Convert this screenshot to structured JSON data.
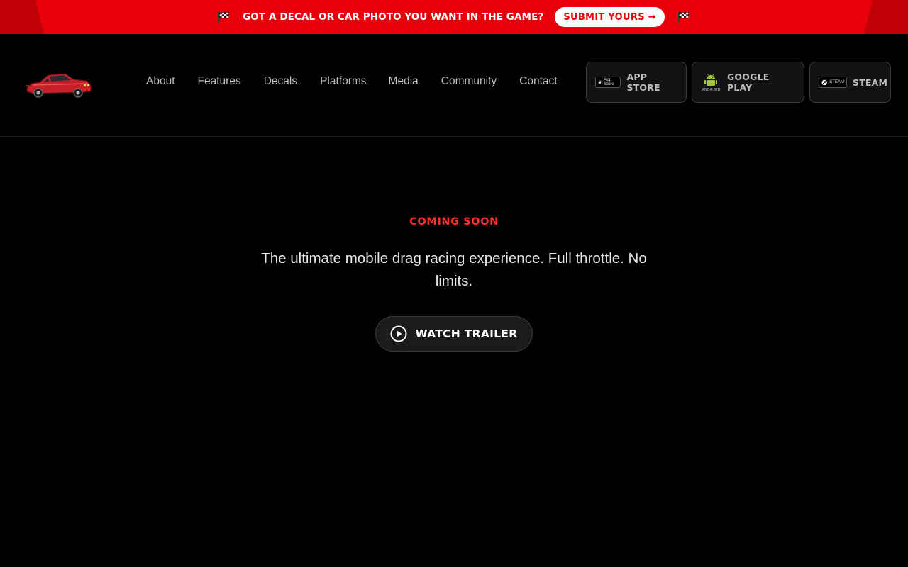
{
  "promo": {
    "text": "GOT A DECAL OR CAR PHOTO YOU WANT IN THE GAME?",
    "button_label": "SUBMIT YOURS →",
    "left_icon": "checkered-flag-icon",
    "right_icon": "checkered-flag-icon",
    "background_color": "#e8000b"
  },
  "header": {
    "logo_icon": "red-car-logo-icon",
    "nav": [
      {
        "label": "About"
      },
      {
        "label": "Features"
      },
      {
        "label": "Decals"
      },
      {
        "label": "Platforms"
      },
      {
        "label": "Media"
      },
      {
        "label": "Community"
      },
      {
        "label": "Contact"
      }
    ],
    "stores": [
      {
        "label": "APP STORE",
        "badge_text": "App Store",
        "icon": "apple-icon"
      },
      {
        "label": "GOOGLE PLAY",
        "badge_text": "ANDROID",
        "icon": "android-icon"
      },
      {
        "label": "STEAM",
        "badge_text": "STEAM",
        "icon": "steam-icon"
      }
    ]
  },
  "hero": {
    "eyebrow": "COMING SOON",
    "tagline": "The ultimate mobile drag racing experience. Full throttle. No limits.",
    "trailer_button_label": "WATCH TRAILER",
    "trailer_icon": "play-circle-icon",
    "accent_color": "#ff2d2d"
  }
}
